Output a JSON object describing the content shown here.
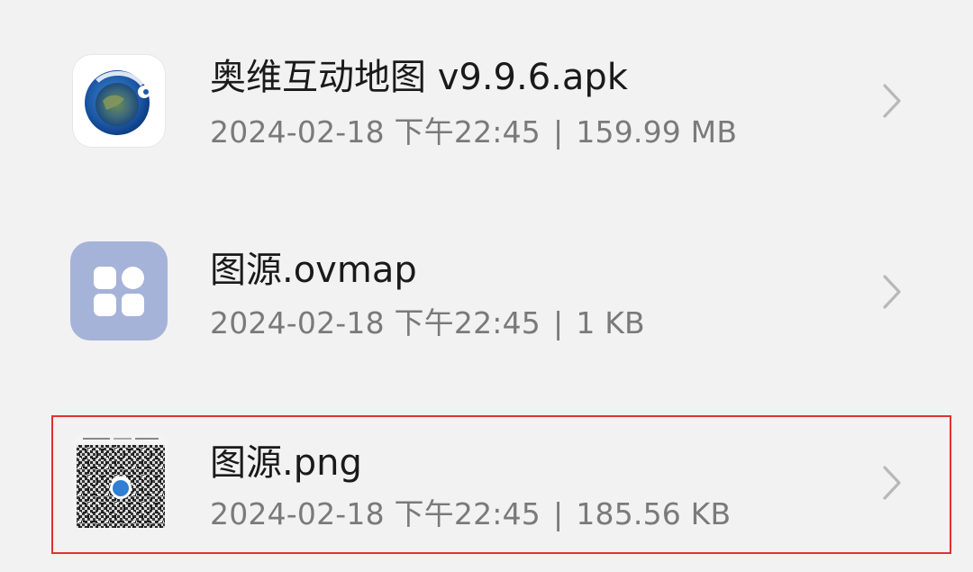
{
  "files": [
    {
      "name": "奥维互动地图 v9.9.6.apk",
      "date": "2024-02-18 下午22:45",
      "separator": "|",
      "size": "159.99 MB",
      "icon": "ovital-map-app-icon"
    },
    {
      "name": "图源.ovmap",
      "date": "2024-02-18 下午22:45",
      "separator": "|",
      "size": "1 KB",
      "icon": "ovmap-file-icon"
    },
    {
      "name": "图源.png",
      "date": "2024-02-18 下午22:45",
      "separator": "|",
      "size": "185.56 KB",
      "icon": "qr-code-image-thumbnail"
    }
  ],
  "colors": {
    "background": "#f2f2f2",
    "highlight": "#e0322f",
    "ovmap_icon_bg": "#a6b3d8"
  }
}
